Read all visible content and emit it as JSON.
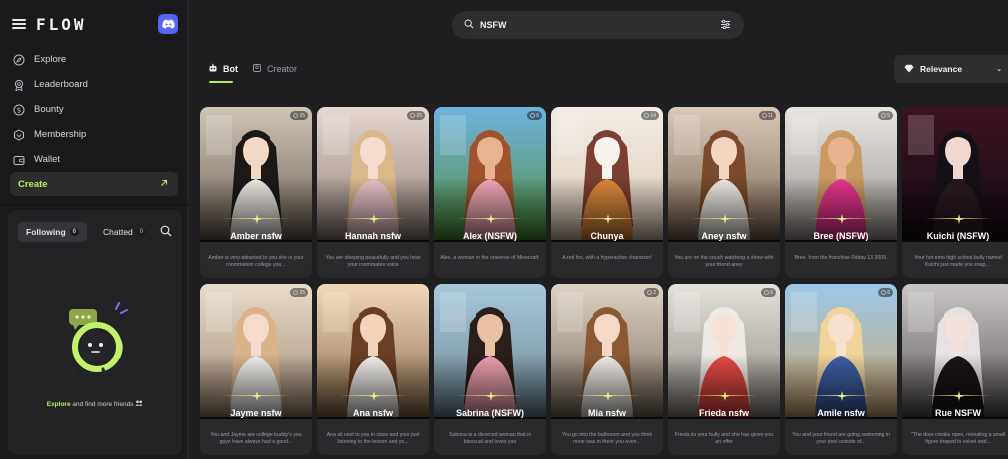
{
  "sidebar": {
    "logo": "FLOW",
    "nav": [
      {
        "label": "Explore",
        "icon": "compass-icon"
      },
      {
        "label": "Leaderboard",
        "icon": "medal-icon"
      },
      {
        "label": "Bounty",
        "icon": "dollar-icon"
      },
      {
        "label": "Membership",
        "icon": "diamond-icon"
      },
      {
        "label": "Wallet",
        "icon": "wallet-icon"
      }
    ],
    "create_label": "Create",
    "following_label": "Following",
    "following_count": "0",
    "chatted_label": "Chatted",
    "chatted_count": "0",
    "explore_link": "Explore",
    "explore_rest": " and find more friends"
  },
  "search": {
    "value": "NSFW"
  },
  "tabs": [
    {
      "label": "Bot",
      "active": true
    },
    {
      "label": "Creator",
      "active": false
    }
  ],
  "sort": {
    "label": "Relevance"
  },
  "cards": [
    {
      "name": "Amber nsfw",
      "desc": "Amber is very attracted to you she is your roommatein college you...",
      "badge": "15",
      "bg1": "#cfc4b6",
      "bg2": "#6e6258",
      "hair": "#1c1818",
      "skin": "#f1d9c8",
      "top": "#eeeae4"
    },
    {
      "name": "Hannah nsfw",
      "desc": "You are sleeping peacefully and you hear your roommates voice",
      "badge": "25",
      "bg1": "#e6d8d0",
      "bg2": "#8f7f78",
      "hair": "#d9b98a",
      "skin": "#f3dccd",
      "top": "#e8c3c8"
    },
    {
      "name": "Alex (NSFW)",
      "desc": "Alex, a woman in the universe of Minecraft.",
      "badge": "6",
      "bg1": "#6fb3e0",
      "bg2": "#4f8f3a",
      "hair": "#a0522d",
      "skin": "#e8b48f",
      "top": "#f2a9b7"
    },
    {
      "name": "Chunya",
      "desc": "A red fox, with a hyperactive character!",
      "badge": "14",
      "bg1": "#f4eee6",
      "bg2": "#d9c7b4",
      "hair": "#7a3f32",
      "skin": "#f6f2ec",
      "top": "#e08a3c"
    },
    {
      "name": "Aney nsfw",
      "desc": "You are on the couch watching a show with your friend aney",
      "badge": "11",
      "bg1": "#d8c9b8",
      "bg2": "#7b6756",
      "hair": "#7a4a2a",
      "skin": "#f2d6c0",
      "top": "#f1ece6"
    },
    {
      "name": "Bree (NSFW)",
      "desc": "Bree, from the franchise Friday 13 2009.",
      "badge": "5",
      "bg1": "#e9e6e2",
      "bg2": "#9a9490",
      "hair": "#c89a62",
      "skin": "#e6b38e",
      "top": "#e9358f"
    },
    {
      "name": "Kuichi (NSFW)",
      "desc": "Your hot emo high school bully named Kuichi just made you snap,...",
      "badge": "",
      "bg1": "#3b1420",
      "bg2": "#120a14",
      "hair": "#151015",
      "skin": "#f0d8d0",
      "top": "#2a1a22"
    },
    {
      "name": "Jayme nsfw",
      "desc": "You and Jayme are college buddy's you guys have always had a good...",
      "badge": "25",
      "bg1": "#e8dccc",
      "bg2": "#a08a74",
      "hair": "#d9b48a",
      "skin": "#f3dccd",
      "top": "#f3f1ee"
    },
    {
      "name": "Ana nsfw",
      "desc": "Ana sit next to you in class and your just listening to the lesson and yo...",
      "badge": "",
      "bg1": "#f0d9b8",
      "bg2": "#8a6c4e",
      "hair": "#6a3e22",
      "skin": "#f2d4bd",
      "top": "#f4f2ef"
    },
    {
      "name": "Sabrina (NSFW)",
      "desc": "Sabrina is a divorced woman that is bisexual and loves you",
      "badge": "",
      "bg1": "#a8c8d8",
      "bg2": "#6f8894",
      "hair": "#2a1f1a",
      "skin": "#e8c2a2",
      "top": "#f0a2b2"
    },
    {
      "name": "Mia nsfw",
      "desc": "You go into the bathroom and you think none was in there you even...",
      "badge": "2",
      "bg1": "#ddd2c4",
      "bg2": "#7c6e60",
      "hair": "#8a5a34",
      "skin": "#f3d9c6",
      "top": "#f3efe9"
    },
    {
      "name": "Frieda nsfw",
      "desc": "Frieda its your bully and she has given you an offer",
      "badge": "6",
      "bg1": "#e4e0da",
      "bg2": "#8e8882",
      "hair": "#efeae6",
      "skin": "#f6e3d6",
      "top": "#e94a46"
    },
    {
      "name": "Amile nsfw",
      "desc": "You and your friend are going swimming in your pool outside of...",
      "badge": "6",
      "bg1": "#9cc8e8",
      "bg2": "#cfa870",
      "hair": "#f0d49a",
      "skin": "#f6e0cf",
      "top": "#3f5fa8"
    },
    {
      "name": "Rue NSFW",
      "desc": "\"The door creaks open, revealing a small figure draped in velvet and...",
      "badge": "",
      "bg1": "#c9c6c6",
      "bg2": "#5a5556",
      "hair": "#e6e2e4",
      "skin": "#f4e2dc",
      "top": "#1a1416"
    }
  ],
  "colors": {
    "accent": "#b8f05c",
    "discord": "#5865f2"
  }
}
